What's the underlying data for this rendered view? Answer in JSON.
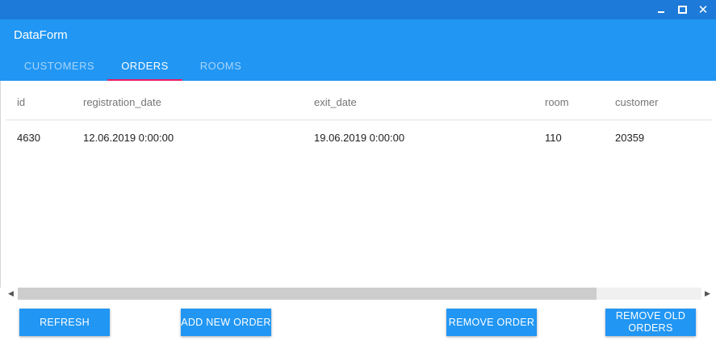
{
  "window": {
    "minimize_icon": "minimize-icon",
    "maximize_icon": "maximize-icon",
    "close_icon": "close-icon",
    "close_glyph": "✕"
  },
  "app": {
    "title": "DataForm",
    "colors": {
      "titlebar": "#1e7ad8",
      "primary": "#2196f3",
      "tab_indicator": "#e91e63"
    }
  },
  "tabs": [
    {
      "label": "CUSTOMERS",
      "active": false
    },
    {
      "label": "ORDERS",
      "active": true
    },
    {
      "label": "ROOMS",
      "active": false
    }
  ],
  "grid": {
    "columns": [
      "id",
      "registration_date",
      "exit_date",
      "room",
      "customer"
    ],
    "rows": [
      {
        "id": "4630",
        "registration_date": "12.06.2019 0:00:00",
        "exit_date": "19.06.2019 0:00:00",
        "room": "110",
        "customer": "20359"
      }
    ],
    "scroll_left_glyph": "◀",
    "scroll_right_glyph": "▶"
  },
  "actions": {
    "refresh": "REFRESH",
    "add_new_order": "ADD NEW ORDER",
    "remove_order": "REMOVE ORDER",
    "remove_old_orders": "REMOVE OLD ORDERS"
  }
}
